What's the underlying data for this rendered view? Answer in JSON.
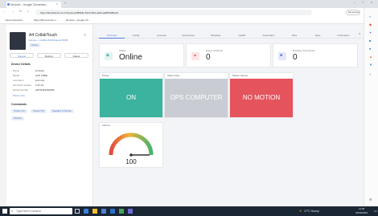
{
  "browser": {
    "tab_title": "Devices - Google Chromebo...",
    "url": "https://fluid.bitrock.com/?devices/0fff9b4e-5212-4f9c-a02a-aa8f15d8bac9",
    "bookmarks": [
      "Import favourites",
      "https://fluid.netcom.c...",
      "Devices - Google Ch..."
    ],
    "not_syncing_label": "Not syncing"
  },
  "device": {
    "name": "A4 CollabTouch",
    "subtitle": "Access - LAURE (5G/Obama) 03/50",
    "status_chip": "Online",
    "actions": {
      "support": "Support",
      "reboot": "Reboot",
      "delete": "Delete"
    },
    "details_title": "Device Details",
    "details": [
      {
        "label": "Name",
        "value": "Contoso"
      },
      {
        "label": "Model",
        "value": "AUS TREE"
      },
      {
        "label": "Last Seen",
        "value": "just now"
      },
      {
        "label": "Firmware Version",
        "value": "1.07.13"
      },
      {
        "label": "Serial Number",
        "value": "LMTN4Z12SN6M"
      }
    ],
    "show_more": "Show more",
    "commands_title": "Commands",
    "commands": [
      "Power On",
      "Power Off",
      "Speaker & Screen",
      "Reboot"
    ]
  },
  "nav_tabs": [
    "Overview",
    "Config",
    "Licenses",
    "Accessories",
    "Schedule",
    "Health",
    "Automation",
    "Files",
    "Apps",
    "Information"
  ],
  "summary": [
    {
      "label": "Status",
      "value": "Online",
      "color": "#47b5a9"
    },
    {
      "label": "Active Incidents",
      "value": "0",
      "color": "#e85b6b"
    },
    {
      "label": "Pending Commands",
      "value": "0",
      "color": "#5b72dd"
    }
  ],
  "tiles": [
    {
      "header": "Power",
      "value": "ON",
      "color": "#3bb39e"
    },
    {
      "header": "Video Input",
      "value": "OPS COMPUTER",
      "color": "#c9cdd3"
    },
    {
      "header": "Motion Sensor",
      "value": "NO MOTION",
      "color": "#e5535d"
    }
  ],
  "volume": {
    "header": "Volume",
    "value": "100",
    "level": 1.0
  },
  "taskbar": {
    "search_placeholder": "Type here to search",
    "weather": "17°C Sunny",
    "time": "11:05",
    "date": "20/06/2023"
  },
  "colors": {
    "accent": "#4f7fd8"
  }
}
